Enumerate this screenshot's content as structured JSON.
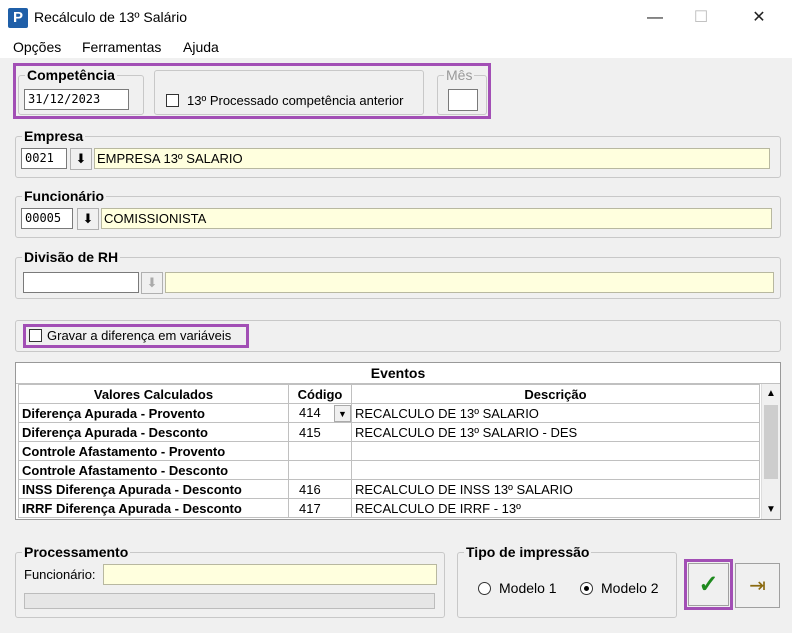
{
  "window": {
    "title": "Recálculo de 13º Salário",
    "minimize": "—",
    "maximize": "☐",
    "close": "✕",
    "icon_letter": "P"
  },
  "menu": [
    "Opções",
    "Ferramentas",
    "Ajuda"
  ],
  "competencia": {
    "label": "Competência",
    "value": "31/12/2023"
  },
  "processado": {
    "label": "13º Processado competência anterior",
    "checked": false
  },
  "mes": {
    "label": "Mês",
    "value": ""
  },
  "empresa": {
    "label": "Empresa",
    "code": "0021",
    "name": "EMPRESA 13º SALARIO"
  },
  "funcionario": {
    "label": "Funcionário",
    "code": "00005",
    "name": "COMISSIONISTA"
  },
  "divisao": {
    "label": "Divisão de RH",
    "code": "",
    "name": ""
  },
  "gravar": {
    "label": "Gravar a diferença em variáveis",
    "checked": false
  },
  "eventos": {
    "title": "Eventos",
    "headers": [
      "Valores Calculados",
      "Código",
      "Descrição"
    ],
    "rows": [
      {
        "valor": "Diferença Apurada - Provento",
        "codigo": "414",
        "descricao": "RECALCULO DE 13º SALARIO"
      },
      {
        "valor": "Diferença Apurada - Desconto",
        "codigo": "415",
        "descricao": "RECALCULO DE 13º SALARIO - DES"
      },
      {
        "valor": "Controle Afastamento - Provento",
        "codigo": "",
        "descricao": ""
      },
      {
        "valor": "Controle Afastamento - Desconto",
        "codigo": "",
        "descricao": ""
      },
      {
        "valor": "INSS Diferença Apurada - Desconto",
        "codigo": "416",
        "descricao": "RECALCULO DE INSS 13º SALARIO"
      },
      {
        "valor": "IRRF Diferença Apurada - Desconto",
        "codigo": "417",
        "descricao": "RECALCULO DE IRRF - 13º"
      }
    ]
  },
  "processamento": {
    "label": "Processamento",
    "funcionario_label": "Funcionário:",
    "funcionario_value": "",
    "progress": 0
  },
  "tipo_impressao": {
    "label": "Tipo de impressão",
    "options": [
      "Modelo 1",
      "Modelo 2"
    ],
    "selected": "Modelo 2"
  },
  "buttons": {
    "confirm_icon": "check-icon",
    "exit_icon": "exit-door-icon",
    "confirm_glyph": "✓",
    "exit_glyph": "⇥"
  },
  "colors": {
    "highlight": "#a24fb5",
    "readonly_field": "#ffffde",
    "confirm_check": "#1e8a1e"
  }
}
